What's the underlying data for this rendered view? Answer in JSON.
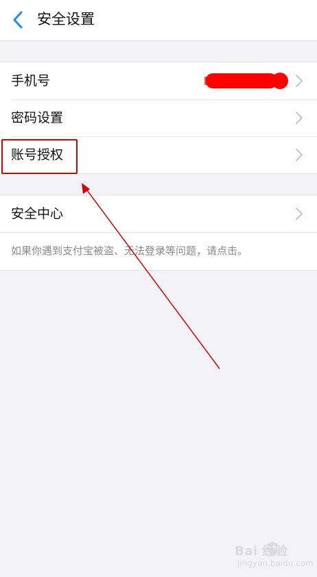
{
  "header": {
    "title": "安全设置"
  },
  "group1": {
    "items": [
      {
        "label": "手机号",
        "value_redacted": true
      },
      {
        "label": "密码设置"
      },
      {
        "label": "账号授权"
      }
    ]
  },
  "group2": {
    "items": [
      {
        "label": "安全中心"
      }
    ],
    "note": "如果你遇到支付宝被盗、无法登录等问题，请点击。"
  },
  "watermark": {
    "brand": "Bai  经验",
    "url": "jingyan.baidu.com"
  },
  "colors": {
    "accent": "#1a8ef1",
    "annotation": "#d60000",
    "redaction": "#ff0000",
    "background": "#f3f3f7"
  },
  "icons": {
    "back": "chevron-left-icon",
    "row_arrow": "chevron-right-icon",
    "watermark_logo": "baidu-paw-icon"
  }
}
